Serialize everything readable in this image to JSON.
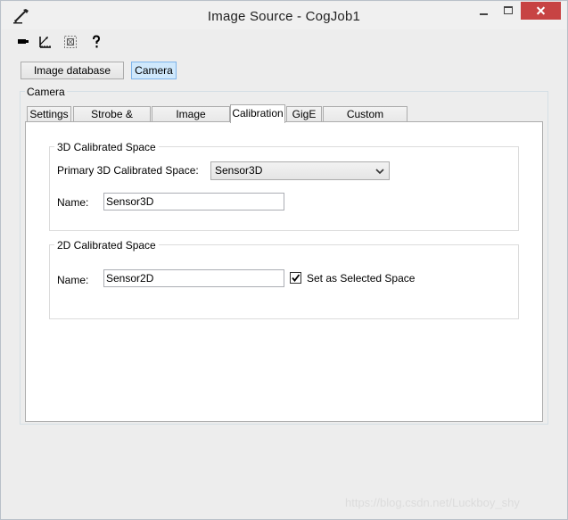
{
  "window": {
    "title": "Image Source - CogJob1",
    "close_color": "#c74343"
  },
  "toolbar": {
    "icons": [
      "eraser-icon",
      "measure-icon",
      "select-region-icon",
      "help-icon"
    ]
  },
  "source_buttons": {
    "image_database": "Image database",
    "camera": "Camera",
    "active": "camera"
  },
  "camera_group": {
    "label": "Camera"
  },
  "tabs": [
    {
      "label": "Settings"
    },
    {
      "label": "Strobe & Trigger"
    },
    {
      "label": "Image Properties"
    },
    {
      "label": "Calibration",
      "selected": true
    },
    {
      "label": "GigE"
    },
    {
      "label": "Custom Properties"
    }
  ],
  "calibration": {
    "space3d": {
      "group_label": "3D Calibrated Space",
      "primary_label": "Primary 3D Calibrated Space:",
      "primary_value": "Sensor3D",
      "name_label": "Name:",
      "name_value": "Sensor3D"
    },
    "space2d": {
      "group_label": "2D Calibrated Space",
      "name_label": "Name:",
      "name_value": "Sensor2D",
      "selected_space_label": "Set as Selected Space",
      "selected_space_checked": true
    }
  },
  "watermark": "https://blog.csdn.net/Luckboy_shy"
}
